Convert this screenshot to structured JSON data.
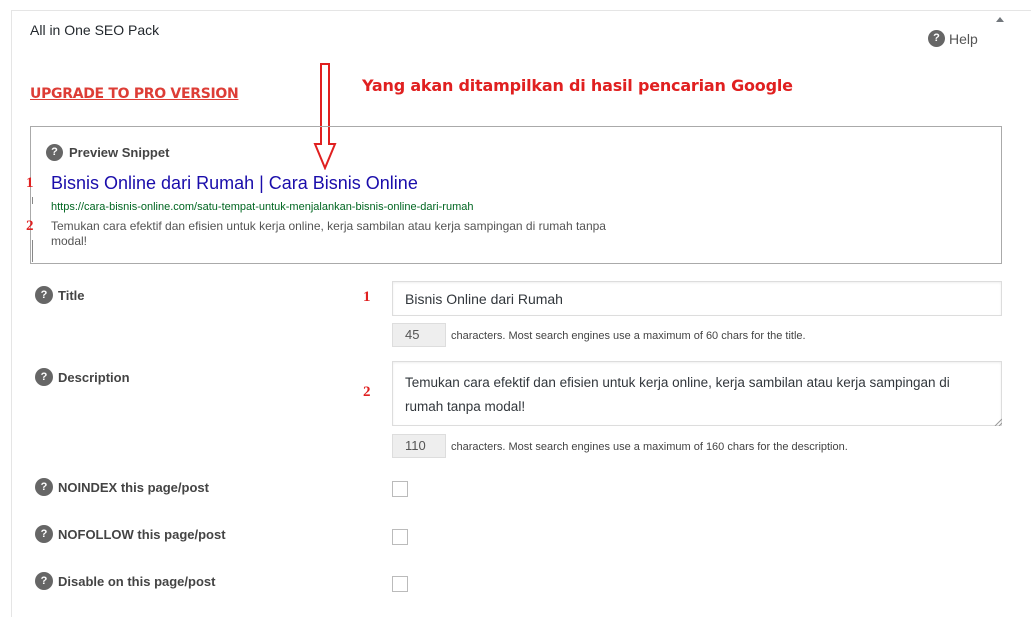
{
  "panel": {
    "title": "All in One SEO Pack",
    "help_label": "Help"
  },
  "upgrade_link": "UPGRADE TO PRO VERSION",
  "annotation": "Yang akan ditampilkan di hasil pencarian Google",
  "markers": {
    "one": "1",
    "two": "2"
  },
  "snippet": {
    "heading": "Preview Snippet",
    "title": "Bisnis Online dari Rumah | Cara Bisnis Online",
    "url": "https://cara-bisnis-online.com/satu-tempat-untuk-menjalankan-bisnis-online-dari-rumah",
    "description": "Temukan cara efektif dan efisien untuk kerja online, kerja sambilan atau kerja sampingan di rumah tanpa modal!"
  },
  "fields": {
    "title": {
      "label": "Title",
      "value": "Bisnis Online dari Rumah",
      "count": "45",
      "hint": "characters. Most search engines use a maximum of 60 chars for the title."
    },
    "description": {
      "label": "Description",
      "value": "Temukan cara efektif dan efisien untuk kerja online, kerja sambilan atau kerja sampingan di rumah tanpa modal!",
      "count": "110",
      "hint": "characters. Most search engines use a maximum of 160 chars for the description."
    },
    "noindex": {
      "label": "NOINDEX this page/post",
      "checked": false
    },
    "nofollow": {
      "label": "NOFOLLOW this page/post",
      "checked": false
    },
    "disable": {
      "label": "Disable on this page/post",
      "checked": false
    }
  },
  "icons": {
    "help": "question-circle-icon",
    "toggle": "caret-up-icon",
    "annotation_arrow": "arrow-down-icon"
  },
  "colors": {
    "link_red": "#dd3d36",
    "annotation_red": "#e02020",
    "serp_title": "#1a0dab",
    "serp_url": "#006621"
  }
}
